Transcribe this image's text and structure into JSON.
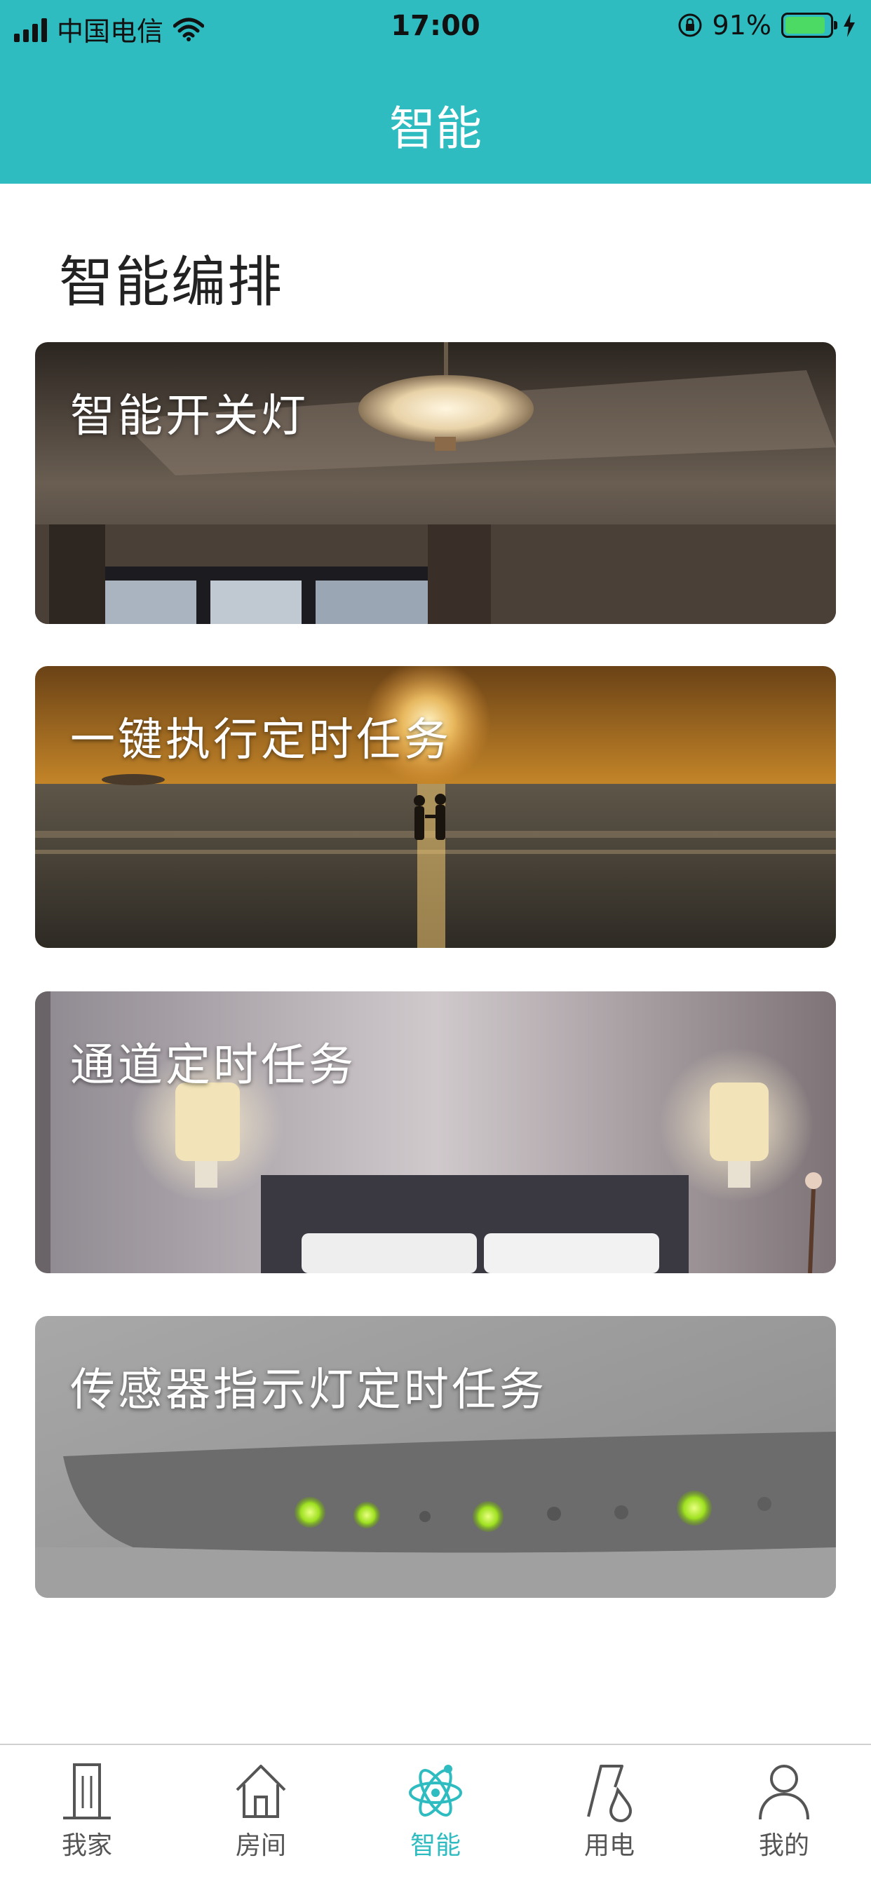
{
  "status_bar": {
    "carrier": "中国电信",
    "time": "17:00",
    "battery": "91%",
    "battery_level": 0.91
  },
  "header": {
    "title": "智能"
  },
  "section": {
    "title": "智能编排"
  },
  "cards": [
    {
      "label": "智能开关灯",
      "image": "ceiling-lamp-room-photo"
    },
    {
      "label": "一键执行定时任务",
      "image": "sunset-beach-couple-photo"
    },
    {
      "label": "通道定时任务",
      "image": "bedroom-wall-lamps-photo"
    },
    {
      "label": "传感器指示灯定时任务",
      "image": "sensor-indicator-lights-photo"
    }
  ],
  "tabs": [
    {
      "label": "我家",
      "icon": "building-icon"
    },
    {
      "label": "房间",
      "icon": "house-icon"
    },
    {
      "label": "智能",
      "icon": "atom-icon"
    },
    {
      "label": "用电",
      "icon": "power-icon"
    },
    {
      "label": "我的",
      "icon": "person-icon"
    }
  ],
  "colors": {
    "accent": "#2fbcc1",
    "tab_inactive": "#555555"
  }
}
